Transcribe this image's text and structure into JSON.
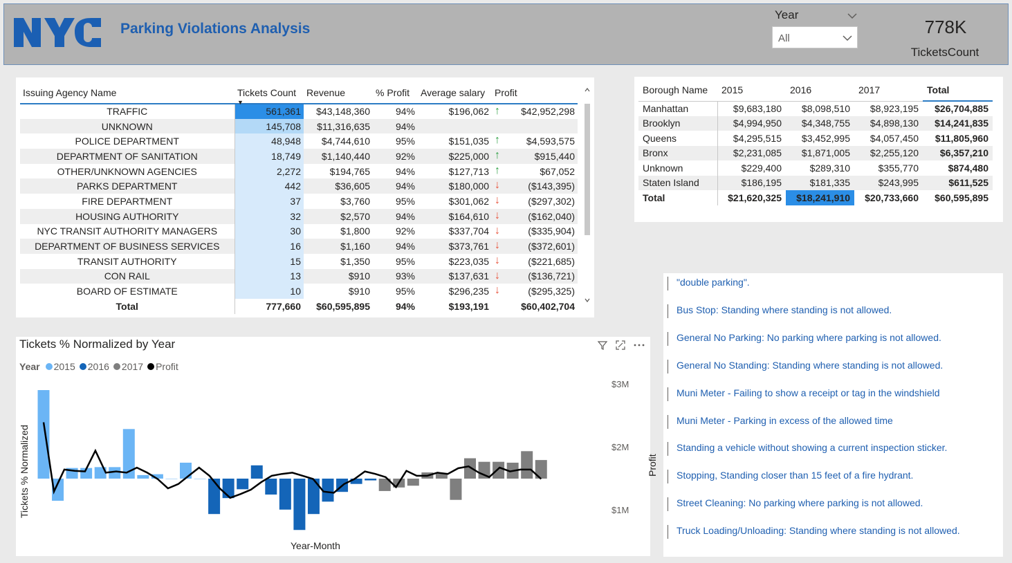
{
  "header": {
    "title": "Parking Violations Analysis",
    "year_filter_label": "Year",
    "year_filter_value": "All",
    "kpi_value": "778K",
    "kpi_label": "TicketsCount"
  },
  "agency_table": {
    "columns": [
      "Issuing Agency Name",
      "Tickets Count",
      "Revenue",
      "% Profit",
      "Average salary",
      "Profit"
    ],
    "rows": [
      {
        "name": "TRAFFIC",
        "tickets": "561,361",
        "revenue": "$43,148,360",
        "pct": "94%",
        "salary": "$196,062",
        "trend": "up",
        "profit": "$42,952,298",
        "bar": 1.0
      },
      {
        "name": "UNKNOWN",
        "tickets": "145,708",
        "revenue": "$11,316,635",
        "pct": "94%",
        "salary": "",
        "trend": "",
        "profit": "",
        "bar": 0.26
      },
      {
        "name": "POLICE DEPARTMENT",
        "tickets": "48,948",
        "revenue": "$4,744,610",
        "pct": "95%",
        "salary": "$151,035",
        "trend": "up",
        "profit": "$4,593,575",
        "bar": 0.09
      },
      {
        "name": "DEPARTMENT OF SANITATION",
        "tickets": "18,749",
        "revenue": "$1,140,440",
        "pct": "92%",
        "salary": "$225,000",
        "trend": "up",
        "profit": "$915,440",
        "bar": 0.03
      },
      {
        "name": "OTHER/UNKNOWN AGENCIES",
        "tickets": "2,272",
        "revenue": "$194,765",
        "pct": "94%",
        "salary": "$127,713",
        "trend": "up",
        "profit": "$67,052",
        "bar": 0.004
      },
      {
        "name": "PARKS DEPARTMENT",
        "tickets": "442",
        "revenue": "$36,605",
        "pct": "94%",
        "salary": "$180,000",
        "trend": "down",
        "profit": "($143,395)",
        "bar": 0.001
      },
      {
        "name": "FIRE DEPARTMENT",
        "tickets": "37",
        "revenue": "$3,760",
        "pct": "95%",
        "salary": "$301,062",
        "trend": "down",
        "profit": "($297,302)",
        "bar": 0
      },
      {
        "name": "HOUSING AUTHORITY",
        "tickets": "32",
        "revenue": "$2,570",
        "pct": "94%",
        "salary": "$164,610",
        "trend": "down",
        "profit": "($162,040)",
        "bar": 0
      },
      {
        "name": "NYC TRANSIT AUTHORITY MANAGERS",
        "tickets": "30",
        "revenue": "$1,800",
        "pct": "92%",
        "salary": "$337,704",
        "trend": "down",
        "profit": "($335,904)",
        "bar": 0
      },
      {
        "name": "DEPARTMENT OF BUSINESS SERVICES",
        "tickets": "16",
        "revenue": "$1,160",
        "pct": "94%",
        "salary": "$373,761",
        "trend": "down",
        "profit": "($372,601)",
        "bar": 0
      },
      {
        "name": "TRANSIT AUTHORITY",
        "tickets": "15",
        "revenue": "$1,350",
        "pct": "95%",
        "salary": "$223,035",
        "trend": "down",
        "profit": "($221,685)",
        "bar": 0
      },
      {
        "name": "CON RAIL",
        "tickets": "13",
        "revenue": "$910",
        "pct": "93%",
        "salary": "$137,631",
        "trend": "down",
        "profit": "($136,721)",
        "bar": 0
      },
      {
        "name": "BOARD OF ESTIMATE",
        "tickets": "10",
        "revenue": "$910",
        "pct": "95%",
        "salary": "$296,235",
        "trend": "down",
        "profit": "($295,325)",
        "bar": 0
      }
    ],
    "total": {
      "name": "Total",
      "tickets": "777,660",
      "revenue": "$60,595,895",
      "pct": "94%",
      "salary": "$193,191",
      "profit": "$60,402,704"
    }
  },
  "borough_table": {
    "columns": [
      "Borough Name",
      "2015",
      "2016",
      "2017",
      "Total"
    ],
    "rows": [
      {
        "name": "Manhattan",
        "y2015": "$9,683,180",
        "y2016": "$8,098,510",
        "y2017": "$8,923,195",
        "total": "$26,704,885"
      },
      {
        "name": "Brooklyn",
        "y2015": "$4,994,950",
        "y2016": "$4,348,755",
        "y2017": "$4,898,130",
        "total": "$14,241,835"
      },
      {
        "name": "Queens",
        "y2015": "$4,295,515",
        "y2016": "$3,452,995",
        "y2017": "$4,057,450",
        "total": "$11,805,960"
      },
      {
        "name": "Bronx",
        "y2015": "$2,231,085",
        "y2016": "$1,871,005",
        "y2017": "$2,255,120",
        "total": "$6,357,210"
      },
      {
        "name": "Unknown",
        "y2015": "$229,400",
        "y2016": "$289,310",
        "y2017": "$355,770",
        "total": "$874,480"
      },
      {
        "name": "Staten Island",
        "y2015": "$186,195",
        "y2016": "$181,335",
        "y2017": "$243,995",
        "total": "$611,525"
      }
    ],
    "total": {
      "name": "Total",
      "y2015": "$21,620,325",
      "y2016": "$18,241,910",
      "y2017": "$20,733,660",
      "total": "$60,595,895"
    }
  },
  "chart": {
    "title": "Tickets % Normalized by Year",
    "legend_title": "Year",
    "ylabel": "Tickets % Normalized",
    "y2label": "Profit",
    "xlabel": "Year-Month",
    "y2ticks": [
      "$3M",
      "$2M",
      "$1M"
    ],
    "colors": {
      "2015": "#6bb5f5",
      "2016": "#1465b8",
      "2017": "#7f7f7f",
      "profit": "#000000"
    }
  },
  "chart_data": {
    "type": "bar",
    "title": "Tickets % Normalized by Year",
    "xlabel": "Year-Month",
    "ylabel": "Tickets % Normalized",
    "y2label": "Profit",
    "y2ticks": [
      "$3M",
      "$2M",
      "$1M"
    ],
    "series": [
      {
        "name": "2015",
        "values": [
          1.0,
          -0.25,
          0.12,
          0.12,
          0.13,
          0.13,
          0.56,
          0.04,
          0.05,
          0.0,
          0.18,
          0.0
        ]
      },
      {
        "name": "2016",
        "values": [
          -0.4,
          -0.22,
          -0.12,
          0.15,
          -0.18,
          -0.35,
          -0.58,
          -0.4,
          -0.26,
          -0.15,
          -0.06,
          -0.02
        ]
      },
      {
        "name": "2017",
        "values": [
          -0.14,
          -0.1,
          -0.08,
          0.07,
          0.06,
          -0.24,
          0.23,
          0.19,
          0.19,
          0.18,
          0.31,
          0.21
        ]
      },
      {
        "name": "Profit",
        "values": [
          2.4,
          1.3,
          1.65,
          1.63,
          1.62,
          1.95,
          1.6,
          1.62,
          1.6,
          1.68,
          1.6,
          1.5,
          1.35,
          1.42,
          1.55,
          1.68,
          1.55,
          1.35,
          1.2,
          1.26,
          1.33,
          1.45,
          1.55,
          1.58,
          1.6,
          1.55,
          1.5,
          1.3,
          1.28,
          1.42,
          1.5,
          1.62,
          1.58,
          1.53,
          1.37,
          1.63,
          1.55,
          1.55,
          1.6,
          1.58,
          1.67,
          1.7,
          1.6,
          1.53,
          1.68,
          1.62,
          1.65,
          1.65,
          1.5
        ]
      }
    ]
  },
  "violations": [
    "\"double parking\".",
    "Bus Stop: Standing where standing is not allowed.",
    "General No Parking: No parking where parking is not allowed.",
    "General No Standing: Standing where standing is not allowed.",
    "Muni Meter - Failing to show a receipt or tag in the windshield",
    "Muni Meter - Parking in excess of the allowed time",
    "Standing a vehicle without showing a current inspection sticker.",
    "Stopping, Standing closer than 15 feet of a fire hydrant.",
    "Street Cleaning: No parking where parking is not allowed.",
    "Truck Loading/Unloading: Standing where standing is not allowed."
  ]
}
